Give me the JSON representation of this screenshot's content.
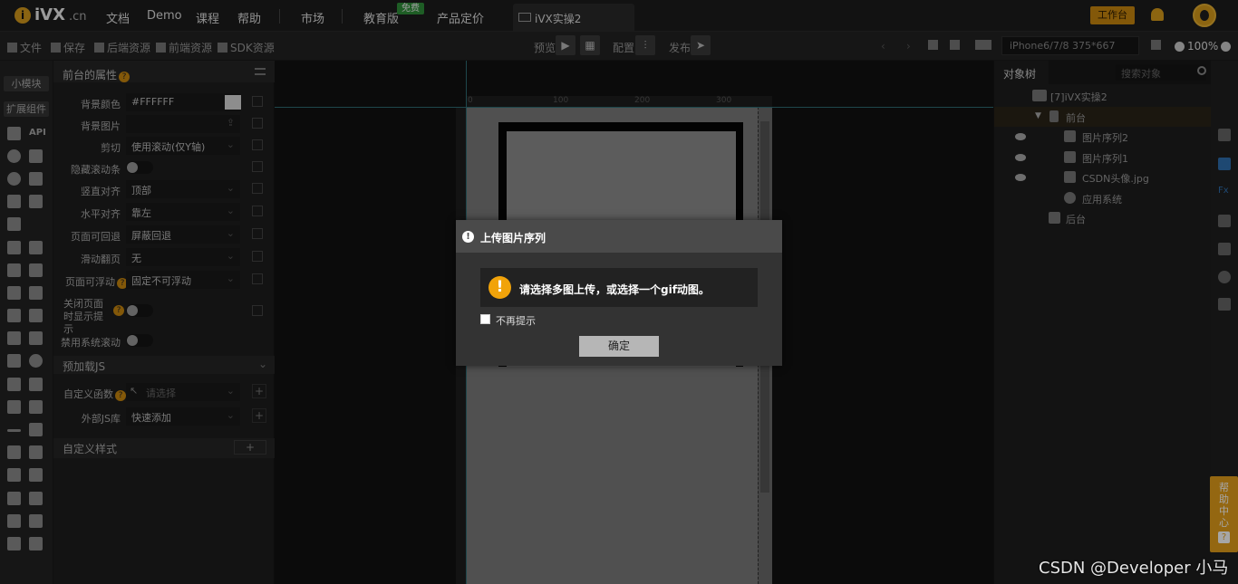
{
  "topnav": {
    "logo_main": "iVX",
    "logo_suffix": ".cn",
    "items": [
      "文档",
      "Demo",
      "课程",
      "帮助",
      "市场",
      "教育版",
      "产品定价"
    ],
    "free_badge": "免费",
    "project_tab": "iVX实操2",
    "workbench_button": "工作台"
  },
  "toolbar": {
    "file": "文件",
    "save": "保存",
    "backend_res": "后端资源",
    "frontend_res": "前端资源",
    "sdk_res": "SDK资源",
    "preview": "预览",
    "config": "配置",
    "publish": "发布",
    "device": "iPhone6/7/8 375*667",
    "zoom": "100%"
  },
  "iconbar": {
    "tab_small_module": "小模块",
    "tab_extension": "扩展组件",
    "api_label": "API"
  },
  "props": {
    "title": "前台的属性",
    "rows": [
      {
        "label": "背景颜色",
        "value": "#FFFFFF"
      },
      {
        "label": "背景图片",
        "value": ""
      },
      {
        "label": "剪切",
        "value": "使用滚动(仅Y轴)"
      },
      {
        "label": "隐藏滚动条",
        "value": ""
      },
      {
        "label": "竖直对齐",
        "value": "顶部"
      },
      {
        "label": "水平对齐",
        "value": "靠左"
      },
      {
        "label": "页面可回退",
        "value": "屏蔽回退"
      },
      {
        "label": "滑动翻页",
        "value": "无"
      },
      {
        "label": "页面可浮动",
        "value": "固定不可浮动"
      },
      {
        "label": "关闭页面时显示提示",
        "value": ""
      },
      {
        "label": "禁用系统滚动",
        "value": ""
      }
    ],
    "preload_section": "预加载JS",
    "custom_func_label": "自定义函数",
    "custom_func_placeholder": "请选择",
    "external_js_label": "外部JS库",
    "external_js_value": "快速添加",
    "custom_style_section": "自定义样式",
    "plus": "+"
  },
  "canvas": {
    "ruler_marks": [
      "0",
      "100",
      "200",
      "300"
    ]
  },
  "object_tree": {
    "tab": "对象树",
    "search_placeholder": "搜索对象",
    "nodes": [
      {
        "label": "[7]iVX实操2"
      },
      {
        "label": "前台"
      },
      {
        "label": "图片序列2"
      },
      {
        "label": "图片序列1"
      },
      {
        "label": "CSDN头像.jpg"
      },
      {
        "label": "应用系统"
      },
      {
        "label": "后台"
      }
    ]
  },
  "help": {
    "text": "帮助中心",
    "q": "?"
  },
  "watermark": "CSDN @Developer 小马",
  "modal": {
    "title": "上传图片序列",
    "message": "请选择多图上传，或选择一个gif动图。",
    "checkbox_label": "不再提示",
    "ok_button": "确定"
  }
}
